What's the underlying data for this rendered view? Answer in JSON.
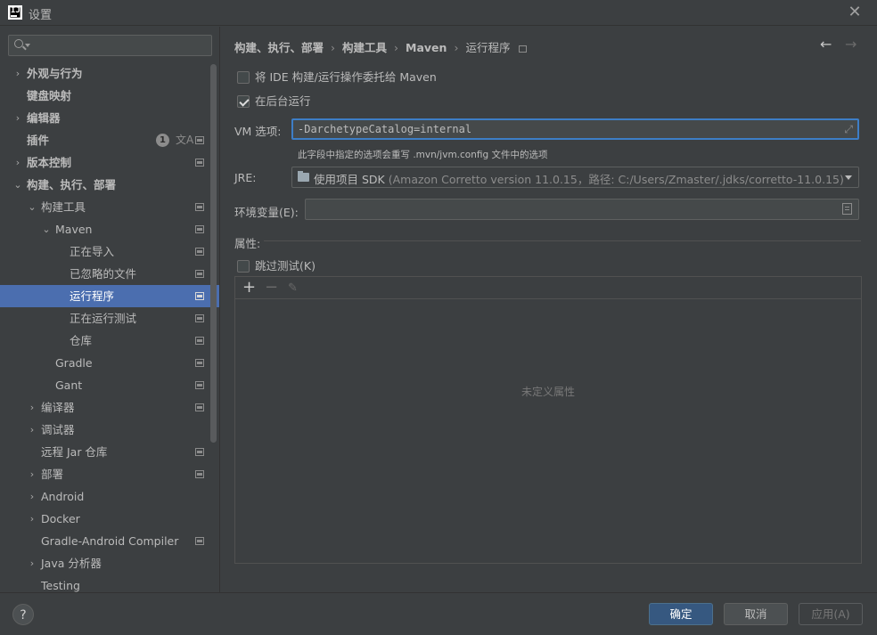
{
  "window": {
    "title": "设置",
    "logo_text": "IJ"
  },
  "sidebar": {
    "search_placeholder": "",
    "items": [
      {
        "label": "外观与行为",
        "level": 0,
        "arrow": "›",
        "bold": true
      },
      {
        "label": "键盘映射",
        "level": 0,
        "arrow": "",
        "bold": true
      },
      {
        "label": "编辑器",
        "level": 0,
        "arrow": "›",
        "bold": true
      },
      {
        "label": "插件",
        "level": 0,
        "arrow": "",
        "bold": true,
        "badge": "1",
        "translate": "文A",
        "cfg": true
      },
      {
        "label": "版本控制",
        "level": 0,
        "arrow": "›",
        "bold": true,
        "cfg": true
      },
      {
        "label": "构建、执行、部署",
        "level": 0,
        "arrow": "⌄",
        "bold": true
      },
      {
        "label": "构建工具",
        "level": 1,
        "arrow": "⌄",
        "cfg": true
      },
      {
        "label": "Maven",
        "level": 2,
        "arrow": "⌄",
        "cfg": true
      },
      {
        "label": "正在导入",
        "level": 3,
        "arrow": "",
        "cfg": true
      },
      {
        "label": "已忽略的文件",
        "level": 3,
        "arrow": "",
        "cfg": true
      },
      {
        "label": "运行程序",
        "level": 3,
        "arrow": "",
        "cfg": true,
        "selected": true
      },
      {
        "label": "正在运行测试",
        "level": 3,
        "arrow": "",
        "cfg": true
      },
      {
        "label": "仓库",
        "level": 3,
        "arrow": "",
        "cfg": true
      },
      {
        "label": "Gradle",
        "level": 2,
        "arrow": "",
        "cfg": true
      },
      {
        "label": "Gant",
        "level": 2,
        "arrow": "",
        "cfg": true
      },
      {
        "label": "编译器",
        "level": 1,
        "arrow": "›",
        "cfg": true
      },
      {
        "label": "调试器",
        "level": 1,
        "arrow": "›"
      },
      {
        "label": "远程 Jar 仓库",
        "level": 1,
        "arrow": "",
        "cfg": true
      },
      {
        "label": "部署",
        "level": 1,
        "arrow": "›",
        "cfg": true
      },
      {
        "label": "Android",
        "level": 1,
        "arrow": "›"
      },
      {
        "label": "Docker",
        "level": 1,
        "arrow": "›"
      },
      {
        "label": "Gradle-Android Compiler",
        "level": 1,
        "arrow": "",
        "cfg": true
      },
      {
        "label": "Java 分析器",
        "level": 1,
        "arrow": "›"
      },
      {
        "label": "Testing",
        "level": 1,
        "arrow": ""
      }
    ]
  },
  "breadcrumb": {
    "items": [
      "构建、执行、部署",
      "构建工具",
      "Maven",
      "运行程序"
    ],
    "separator": "›"
  },
  "nav": {
    "back": "←",
    "forward": "→"
  },
  "form": {
    "delegate_label": "将 IDE 构建/运行操作委托给 Maven",
    "delegate_checked": false,
    "background_label": "在后台运行",
    "background_checked": true,
    "vm_label": "VM 选项:",
    "vm_value": "-DarchetypeCatalog=internal",
    "vm_hint": "此字段中指定的选项会重写 .mvn/jvm.config 文件中的选项",
    "jre_label": "JRE:",
    "jre_value": "使用项目 SDK",
    "jre_detail": "(Amazon Corretto version 11.0.15，路径: C:/Users/Zmaster/.jdks/corretto-11.0.15)",
    "env_label": "环境变量(E):",
    "env_value": ""
  },
  "properties": {
    "title": "属性:",
    "skip_tests_label": "跳过测试(K)",
    "skip_tests_checked": false,
    "empty_text": "未定义属性",
    "add": "+",
    "remove": "−",
    "edit": "✎"
  },
  "footer": {
    "help": "?",
    "ok": "确定",
    "cancel": "取消",
    "apply": "应用(A)"
  },
  "colors": {
    "selection": "#4b6eaf",
    "focus_border": "#3d7ec6",
    "primary_button": "#365880",
    "background": "#3c3f41"
  }
}
